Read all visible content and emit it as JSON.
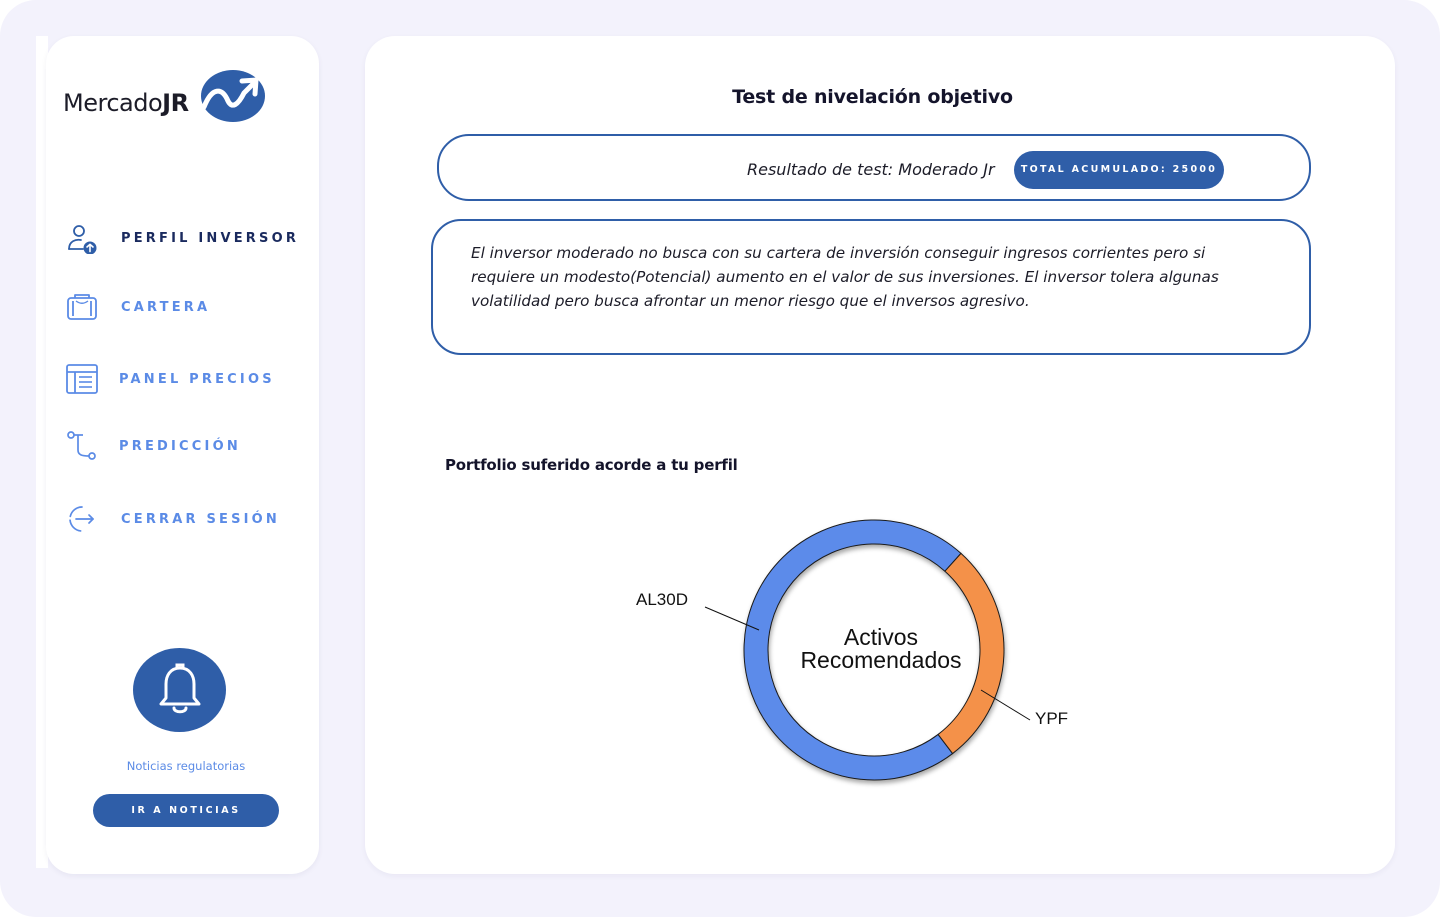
{
  "app": {
    "logo": {
      "name": "Mercado",
      "bold": "JR"
    }
  },
  "sidebar": {
    "items": [
      {
        "label": "PERFIL INVERSOR",
        "icon": "user-upload-icon",
        "active": true
      },
      {
        "label": "CARTERA",
        "icon": "wallet-icon",
        "active": false
      },
      {
        "label": "PANEL PRECIOS",
        "icon": "price-panel-icon",
        "active": false
      },
      {
        "label": "PREDICCIÓN",
        "icon": "prediction-path-icon",
        "active": false
      },
      {
        "label": "CERRAR SESIÓN",
        "icon": "logout-icon",
        "active": false
      }
    ],
    "news": {
      "icon": "bell-icon",
      "label": "Noticias regulatorias",
      "button": "IR A NOTICIAS"
    }
  },
  "main": {
    "title": "Test de nivelación objetivo",
    "result": {
      "text": "Resultado de test: Moderado Jr",
      "badge": "TOTAL ACUMULADO: 25000"
    },
    "description": "El inversor moderado no busca con su cartera de inversión conseguir ingresos corrientes pero si requiere un modesto(Potencial) aumento en el valor de sus inversiones. El inversor tolera algunas volatilidad pero busca afrontar un menor riesgo que el inversos agresivo.",
    "portfolio_title": "Portfolio suferido acorde a tu perfil"
  },
  "colors": {
    "primary": "#2f5ea8",
    "accent": "#5b8be6",
    "series_al30d": "#5b8bea",
    "series_ypf": "#f4914a"
  },
  "chart_data": {
    "type": "pie",
    "title": "",
    "center_label": "Activos Recomendados",
    "labels": [
      "AL30D",
      "YPF"
    ],
    "values": [
      72,
      28
    ]
  }
}
